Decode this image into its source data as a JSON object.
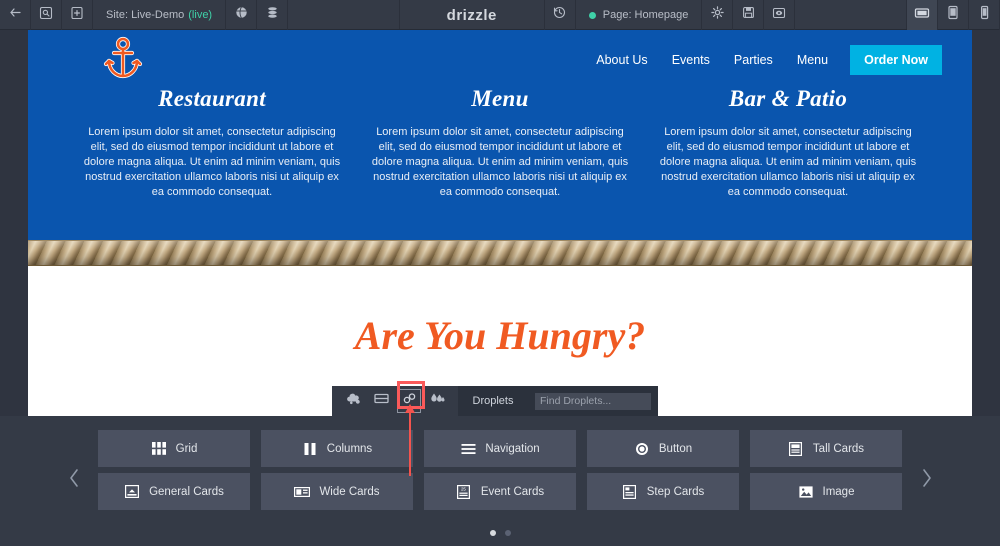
{
  "topbar": {
    "back_icon": "back-arrow-icon",
    "inspect_icon": "inspect-page-icon",
    "add_icon": "add-page-icon",
    "site_label_prefix": "Site: Live-Demo",
    "site_label_status": "(live)",
    "globe_icon": "globe-icon",
    "database_icon": "database-icon",
    "logo": "drizzle",
    "history_icon": "history-icon",
    "page_label": "Page: Homepage",
    "settings_icon": "gear-icon",
    "save_icon": "save-icon",
    "preview_icon": "eye-icon",
    "device_desktop": "desktop-icon",
    "device_tablet": "tablet-icon",
    "device_mobile": "mobile-icon"
  },
  "site": {
    "logo_icon": "anchor-icon",
    "nav": [
      {
        "label": "About Us"
      },
      {
        "label": "Events"
      },
      {
        "label": "Parties"
      },
      {
        "label": "Menu"
      }
    ],
    "cta": "Order Now",
    "columns": [
      {
        "title": "Restaurant",
        "body": "Lorem ipsum dolor sit amet, consectetur adipiscing elit, sed do eiusmod tempor incididunt ut labore et dolore magna aliqua. Ut enim ad minim veniam, quis nostrud exercitation ullamco laboris nisi ut aliquip ex ea commodo consequat."
      },
      {
        "title": "Menu",
        "body": "Lorem ipsum dolor sit amet, consectetur adipiscing elit, sed do eiusmod tempor incididunt ut labore et dolore magna aliqua. Ut enim ad minim veniam, quis nostrud exercitation ullamco laboris nisi ut aliquip ex ea commodo consequat."
      },
      {
        "title": "Bar & Patio",
        "body": "Lorem ipsum dolor sit amet, consectetur adipiscing elit, sed do eiusmod tempor incididunt ut labore et dolore magna aliqua. Ut enim ad minim veniam, quis nostrud exercitation ullamco laboris nisi ut aliquip ex ea commodo consequat."
      }
    ],
    "headline": "Are You Hungry?"
  },
  "droplet_toolbar": {
    "icons": [
      {
        "name": "cloud-splash-icon",
        "highlighted": false
      },
      {
        "name": "split-panel-icon",
        "highlighted": false
      },
      {
        "name": "link-chain-icon",
        "highlighted": true
      },
      {
        "name": "droplets-icon",
        "highlighted": false
      }
    ],
    "tab_label": "Droplets",
    "search_placeholder": "Find Droplets...",
    "search_value": ""
  },
  "droplet_panel": {
    "prev_icon": "chevron-left-icon",
    "next_icon": "chevron-right-icon",
    "cards": [
      {
        "label": "Grid",
        "icon": "grid-icon"
      },
      {
        "label": "Columns",
        "icon": "columns-icon"
      },
      {
        "label": "Navigation",
        "icon": "navigation-icon"
      },
      {
        "label": "Button",
        "icon": "button-icon"
      },
      {
        "label": "Tall Cards",
        "icon": "tall-cards-icon"
      },
      {
        "label": "General Cards",
        "icon": "general-cards-icon"
      },
      {
        "label": "Wide Cards",
        "icon": "wide-cards-icon"
      },
      {
        "label": "Event Cards",
        "icon": "event-cards-icon"
      },
      {
        "label": "Step Cards",
        "icon": "step-cards-icon"
      },
      {
        "label": "Image",
        "icon": "image-icon"
      }
    ],
    "pages": 2,
    "active_page": 1
  },
  "colors": {
    "hero_blue": "#0a55ae",
    "cta_cyan": "#00b2e3",
    "accent_orange": "#f05a22",
    "chrome_dark": "#343a46",
    "annotation_red": "#f4544e",
    "status_green": "#3fd1a8"
  }
}
